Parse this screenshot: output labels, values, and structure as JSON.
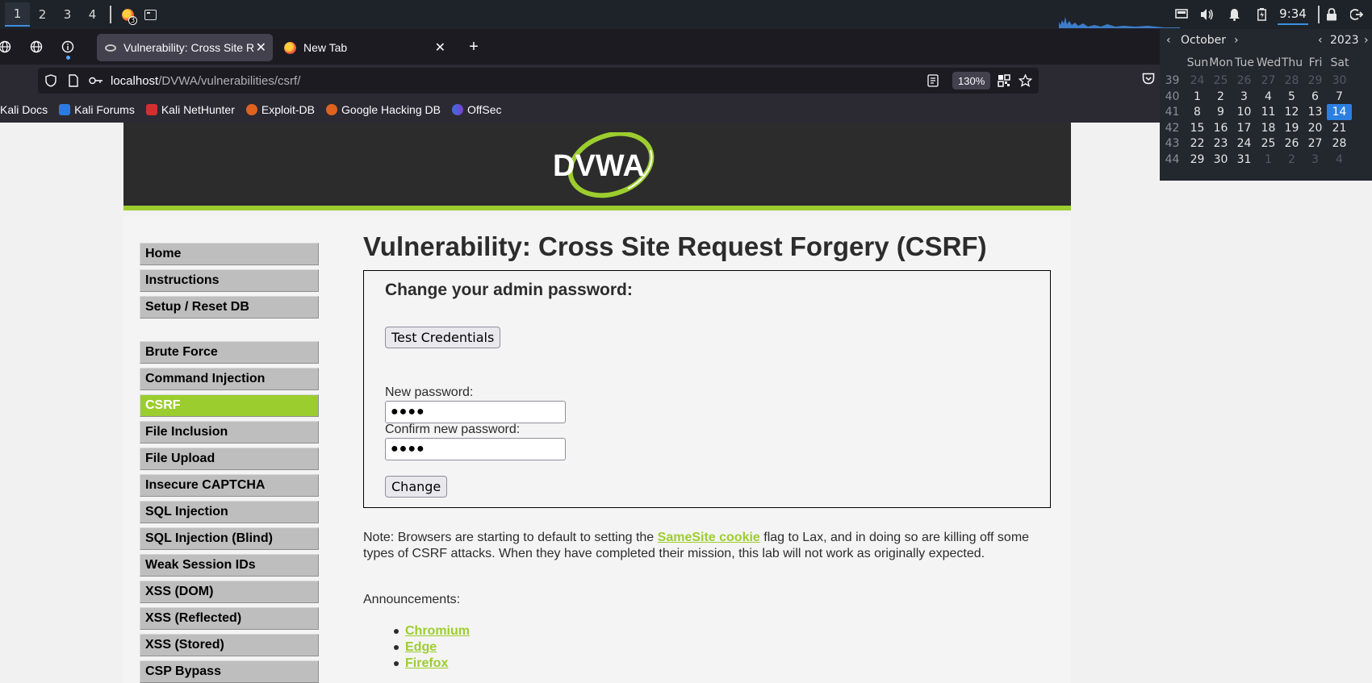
{
  "panel": {
    "workspaces": [
      "1",
      "2",
      "3",
      "4"
    ],
    "firefox_badge": "3",
    "time": "9:34"
  },
  "tabs": [
    {
      "title": "Vulnerability: Cross Site R",
      "active": true
    },
    {
      "title": "New Tab",
      "active": false
    }
  ],
  "url": {
    "host": "localhost",
    "path": "/DVWA/vulnerabilities/csrf/",
    "zoom": "130%"
  },
  "bookmarks": [
    "Kali Docs",
    "Kali Forums",
    "Kali NetHunter",
    "Exploit-DB",
    "Google Hacking DB",
    "OffSec"
  ],
  "dvwa": {
    "logo_text": "DVWA",
    "menu": {
      "group1": [
        "Home",
        "Instructions",
        "Setup / Reset DB"
      ],
      "group2": [
        "Brute Force",
        "Command Injection",
        "CSRF",
        "File Inclusion",
        "File Upload",
        "Insecure CAPTCHA",
        "SQL Injection",
        "SQL Injection (Blind)",
        "Weak Session IDs",
        "XSS (DOM)",
        "XSS (Reflected)",
        "XSS (Stored)",
        "CSP Bypass"
      ],
      "selected": "CSRF"
    },
    "title": "Vulnerability: Cross Site Request Forgery (CSRF)",
    "box": {
      "heading": "Change your admin password:",
      "test_button": "Test Credentials",
      "new_label": "New password:",
      "new_value": "●●●●",
      "confirm_label": "Confirm new password:",
      "confirm_value": "●●●●",
      "change_button": "Change"
    },
    "note": {
      "before": "Note: Browsers are starting to default to setting the ",
      "link": "SameSite cookie",
      "after": " flag to Lax, and in doing so are killing off some types of CSRF attacks. When they have completed their mission, this lab will not work as originally expected."
    },
    "announcements_label": "Announcements:",
    "announcements": [
      "Chromium",
      "Edge",
      "Firefox"
    ]
  },
  "calendar": {
    "month": "October",
    "year": "2023",
    "weekdays": [
      "Sun",
      "Mon",
      "Tue",
      "Wed",
      "Thu",
      "Fri",
      "Sat"
    ],
    "weeks": [
      {
        "num": "39",
        "days": [
          "24",
          "25",
          "26",
          "27",
          "28",
          "29",
          "30"
        ],
        "muted": [
          true,
          true,
          true,
          true,
          true,
          true,
          true
        ]
      },
      {
        "num": "40",
        "days": [
          "1",
          "2",
          "3",
          "4",
          "5",
          "6",
          "7"
        ],
        "muted": [
          false,
          false,
          false,
          false,
          false,
          false,
          false
        ]
      },
      {
        "num": "41",
        "days": [
          "8",
          "9",
          "10",
          "11",
          "12",
          "13",
          "14"
        ],
        "muted": [
          false,
          false,
          false,
          false,
          false,
          false,
          false
        ]
      },
      {
        "num": "42",
        "days": [
          "15",
          "16",
          "17",
          "18",
          "19",
          "20",
          "21"
        ],
        "muted": [
          false,
          false,
          false,
          false,
          false,
          false,
          false
        ]
      },
      {
        "num": "43",
        "days": [
          "22",
          "23",
          "24",
          "25",
          "26",
          "27",
          "28"
        ],
        "muted": [
          false,
          false,
          false,
          false,
          false,
          false,
          false
        ]
      },
      {
        "num": "44",
        "days": [
          "29",
          "30",
          "31",
          "1",
          "2",
          "3",
          "4"
        ],
        "muted": [
          false,
          false,
          false,
          true,
          true,
          true,
          true
        ]
      }
    ],
    "today": "14"
  },
  "colors": {
    "dvwa_green": "#9ccd2e",
    "accent_blue": "#2b7fe0"
  }
}
